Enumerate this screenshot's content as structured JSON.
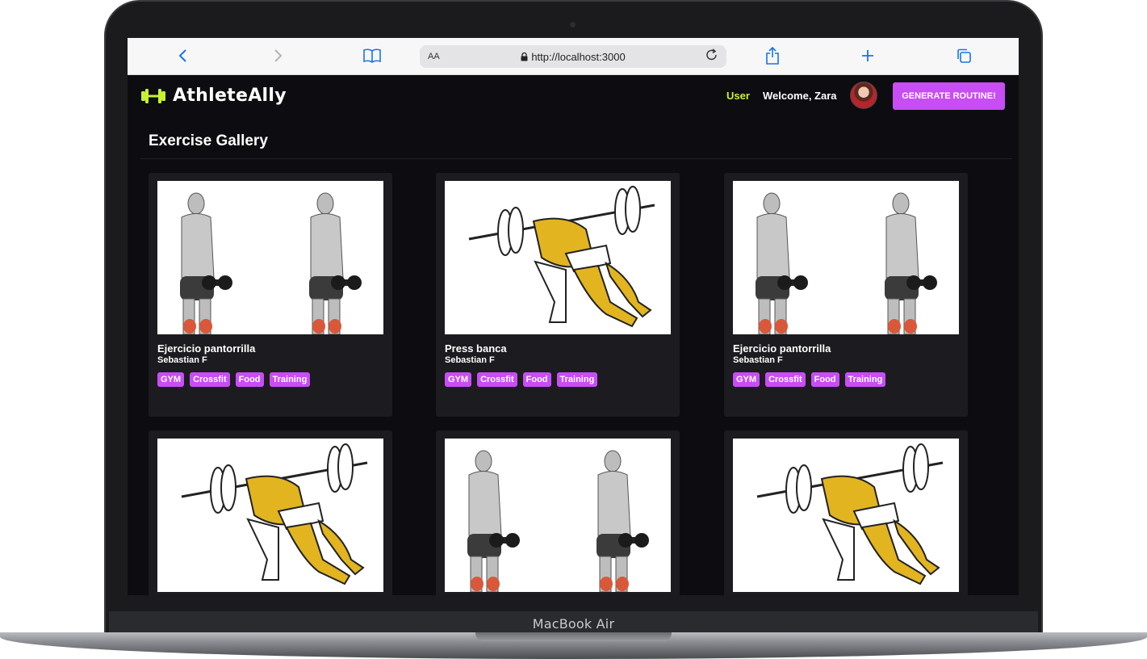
{
  "device": {
    "label": "MacBook Air"
  },
  "browser": {
    "text_size": "AA",
    "url": "http://localhost:3000"
  },
  "header": {
    "brand": "AthleteAlly",
    "role": "User",
    "welcome": "Welcome, Zara",
    "cta": "GENERATE ROUTINE!"
  },
  "gallery": {
    "title": "Exercise Gallery",
    "cards": [
      {
        "title": "Ejercicio pantorrilla",
        "author": "Sebastian F",
        "image": "calf-raise-illustration",
        "tags": [
          "GYM",
          "Crossfit",
          "Food",
          "Training"
        ]
      },
      {
        "title": "Press banca",
        "author": "Sebastian F",
        "image": "bench-press-illustration",
        "tags": [
          "GYM",
          "Crossfit",
          "Food",
          "Training"
        ]
      },
      {
        "title": "Ejercicio pantorrilla",
        "author": "Sebastian F",
        "image": "calf-raise-illustration",
        "tags": [
          "GYM",
          "Crossfit",
          "Food",
          "Training"
        ]
      },
      {
        "title": "",
        "author": "",
        "image": "bench-press-illustration",
        "tags": []
      },
      {
        "title": "",
        "author": "",
        "image": "calf-raise-illustration",
        "tags": []
      },
      {
        "title": "",
        "author": "",
        "image": "bench-press-illustration",
        "tags": []
      }
    ]
  },
  "colors": {
    "accent": "#c84df5",
    "brand": "#c6f135",
    "background": "#0d0c10",
    "card": "#1c1b1f"
  }
}
